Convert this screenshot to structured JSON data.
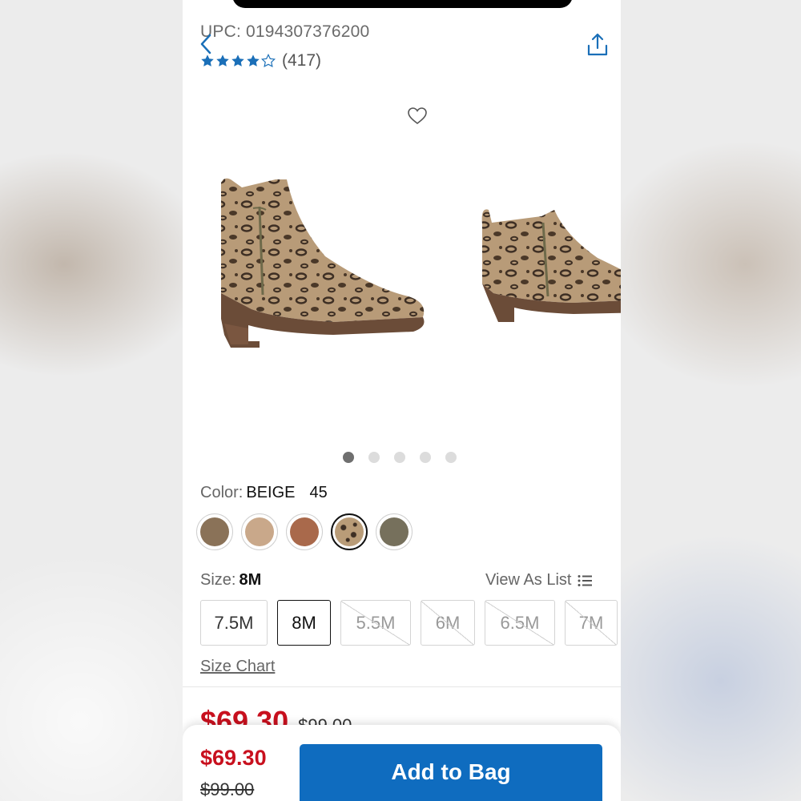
{
  "product": {
    "upc_label": "UPC: 0194307376200",
    "rating_count": "(417)",
    "rating_stars": 4
  },
  "gallery": {
    "dot_count": 5,
    "active_dot": 0
  },
  "color": {
    "label": "Color:",
    "value": "BEIGE",
    "count": "45",
    "swatches": [
      {
        "name": "brown",
        "color": "#8a7258"
      },
      {
        "name": "tan",
        "color": "#c9a88a"
      },
      {
        "name": "cognac",
        "color": "#a9694b"
      },
      {
        "name": "leopard",
        "color": "#b99c78"
      },
      {
        "name": "olive",
        "color": "#76705c"
      }
    ],
    "selected_index": 3
  },
  "size": {
    "label": "Size:",
    "value": "8M",
    "view_as_list": "View As List",
    "options": [
      {
        "label": "7.5M",
        "state": "available"
      },
      {
        "label": "8M",
        "state": "selected"
      },
      {
        "label": "5.5M",
        "state": "unavailable"
      },
      {
        "label": "6M",
        "state": "unavailable"
      },
      {
        "label": "6.5M",
        "state": "unavailable"
      },
      {
        "label": "7M",
        "state": "unavailable"
      }
    ],
    "size_chart": "Size Chart"
  },
  "price": {
    "sale": "$69.30",
    "original": "$99.00"
  },
  "bottom_bar": {
    "sale": "$69.30",
    "original": "$99.00",
    "add_to_bag": "Add to Bag"
  },
  "colors": {
    "accent_blue": "#0f6cbf",
    "sale_red": "#c8101e",
    "star_blue": "#1a6fb8"
  }
}
